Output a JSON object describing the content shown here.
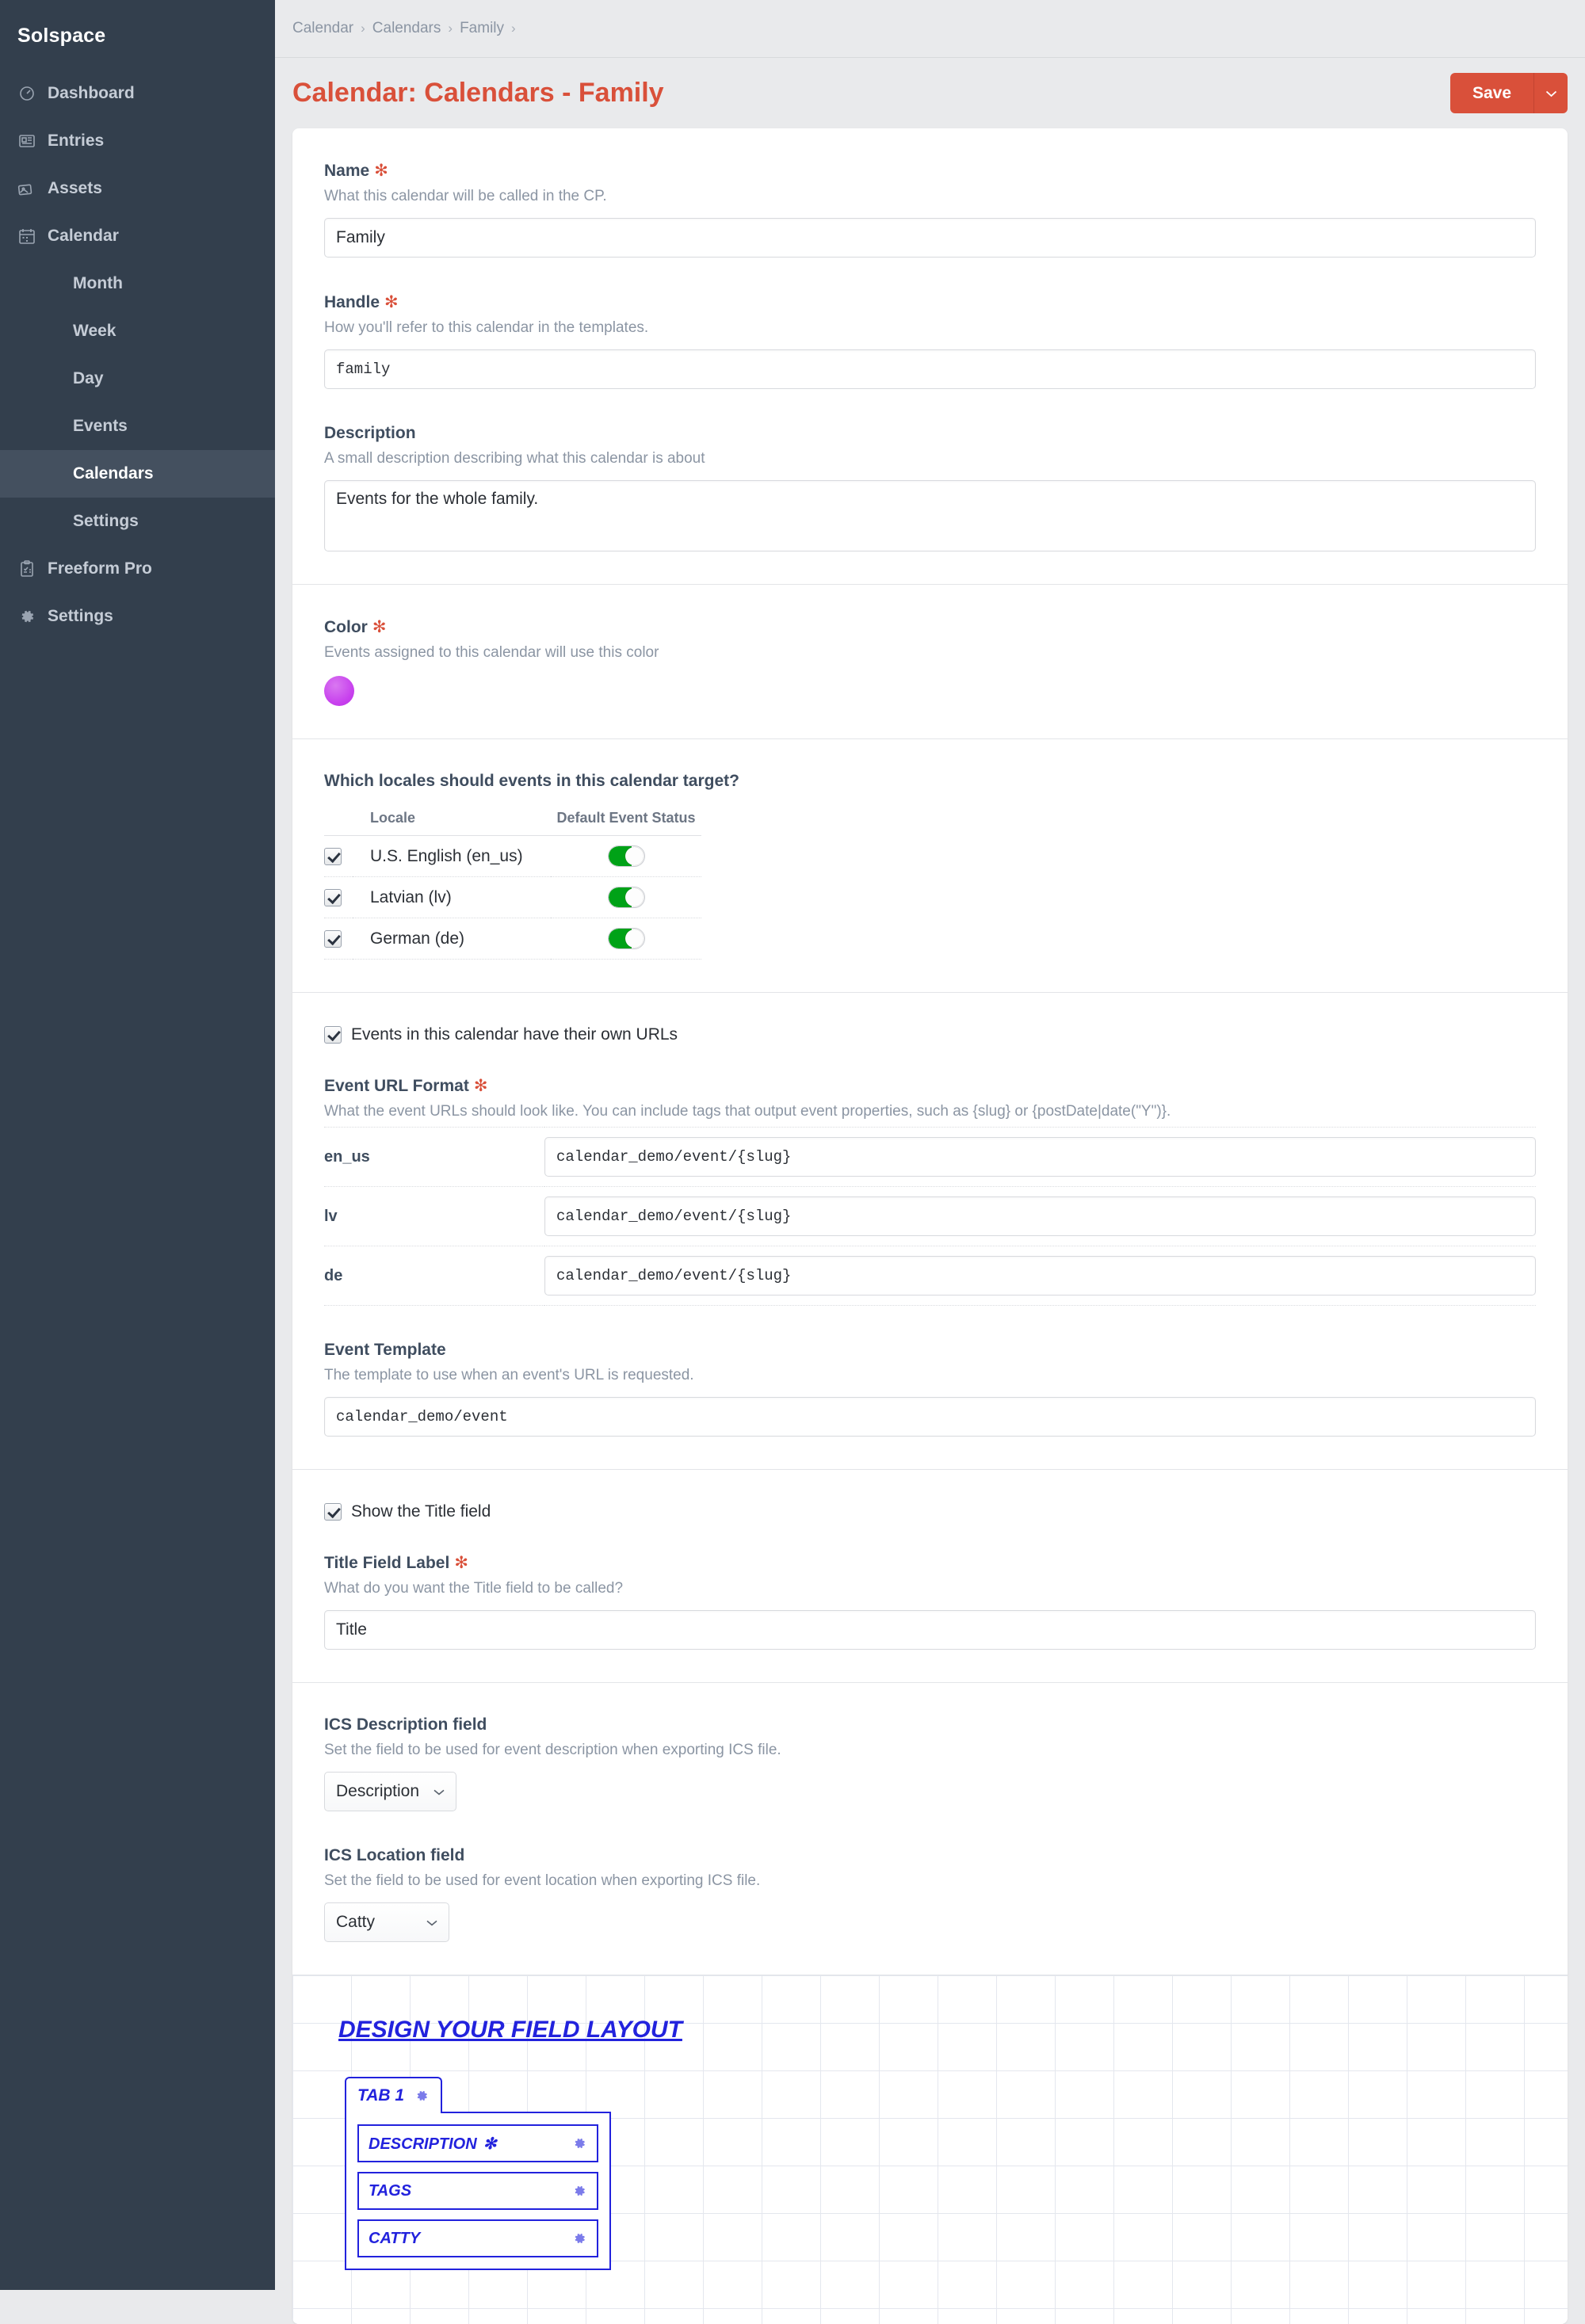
{
  "sidebar": {
    "brand": "Solspace",
    "items": [
      {
        "label": "Dashboard",
        "icon": "dashboard-icon"
      },
      {
        "label": "Entries",
        "icon": "entries-icon"
      },
      {
        "label": "Assets",
        "icon": "assets-icon"
      },
      {
        "label": "Calendar",
        "icon": "calendar-icon"
      }
    ],
    "sub_items": [
      {
        "label": "Month",
        "active": false
      },
      {
        "label": "Week",
        "active": false
      },
      {
        "label": "Day",
        "active": false
      },
      {
        "label": "Events",
        "active": false
      },
      {
        "label": "Calendars",
        "active": true
      },
      {
        "label": "Settings",
        "active": false
      }
    ],
    "bottom_items": [
      {
        "label": "Freeform Pro",
        "icon": "clipboard-icon"
      },
      {
        "label": "Settings",
        "icon": "gear-icon"
      }
    ]
  },
  "breadcrumb": {
    "items": [
      "Calendar",
      "Calendars",
      "Family"
    ],
    "separator": "›"
  },
  "header": {
    "title": "Calendar: Calendars - Family",
    "save_label": "Save",
    "save_menu_icon": "chevron-down-icon",
    "accent_color": "#d9503a"
  },
  "form": {
    "name": {
      "label": "Name",
      "required": "✻",
      "instructions": "What this calendar will be called in the CP.",
      "value": "Family"
    },
    "handle": {
      "label": "Handle",
      "required": "✻",
      "instructions": "How you'll refer to this calendar in the templates.",
      "value": "family"
    },
    "description": {
      "label": "Description",
      "instructions": "A small description describing what this calendar is about",
      "value": "Events for the whole family."
    },
    "color": {
      "label": "Color",
      "required": "✻",
      "instructions": "Events assigned to this calendar will use this color",
      "value": "#c842ee"
    },
    "locales": {
      "title": "Which locales should events in this calendar target?",
      "columns": [
        "Locale",
        "Default Event Status"
      ],
      "rows": [
        {
          "label": "U.S. English (en_us)",
          "checked": true,
          "status_on": true
        },
        {
          "label": "Latvian (lv)",
          "checked": true,
          "status_on": true
        },
        {
          "label": "German (de)",
          "checked": true,
          "status_on": true
        }
      ]
    },
    "own_urls": {
      "label": "Events in this calendar have their own URLs",
      "checked": true
    },
    "event_url_format": {
      "label": "Event URL Format",
      "required": "✻",
      "instructions": "What the event URLs should look like. You can include tags that output event properties, such as {slug} or {postDate|date(\"Y\")}.",
      "rows": [
        {
          "key": "en_us",
          "value": "calendar_demo/event/{slug}"
        },
        {
          "key": "lv",
          "value": "calendar_demo/event/{slug}"
        },
        {
          "key": "de",
          "value": "calendar_demo/event/{slug}"
        }
      ]
    },
    "event_template": {
      "label": "Event Template",
      "instructions": "The template to use when an event's URL is requested.",
      "value": "calendar_demo/event"
    },
    "show_title": {
      "label": "Show the Title field",
      "checked": true
    },
    "title_field_label": {
      "label": "Title Field Label",
      "required": "✻",
      "instructions": "What do you want the Title field to be called?",
      "value": "Title"
    },
    "ics_description": {
      "label": "ICS Description field",
      "instructions": "Set the field to be used for event description when exporting ICS file.",
      "value": "Description",
      "carat": "⌄"
    },
    "ics_location": {
      "label": "ICS Location field",
      "instructions": "Set the field to be used for event location when exporting ICS file.",
      "value": "Catty",
      "carat": "⌄"
    }
  },
  "field_layout": {
    "heading": "DESIGN YOUR FIELD LAYOUT",
    "tab_label": "TAB 1",
    "accent_color": "#2222dd",
    "fields": [
      {
        "label": "DESCRIPTION",
        "required": "✻"
      },
      {
        "label": "TAGS",
        "required": ""
      },
      {
        "label": "CATTY",
        "required": ""
      }
    ]
  }
}
